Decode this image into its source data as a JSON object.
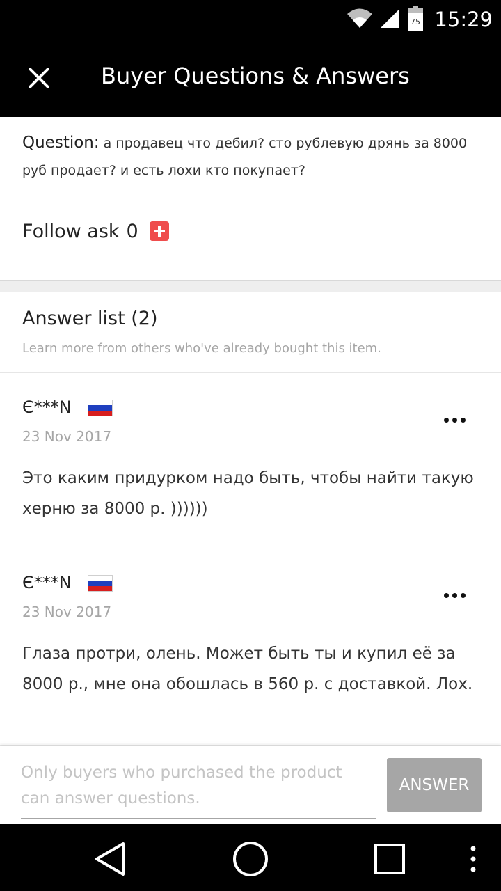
{
  "status_bar": {
    "time": "15:29",
    "battery_level": "75",
    "icons": [
      "wifi-icon",
      "cellular-signal-icon",
      "battery-icon"
    ]
  },
  "header": {
    "title": "Buyer Questions & Answers",
    "close_icon": "close-icon"
  },
  "question": {
    "label": "Question:",
    "text": "а продавец что дебил? сто рублевую дрянь за 8000 руб продает? и есть лохи кто покупает?",
    "follow_label": "Follow ask",
    "follow_count": "0",
    "follow_icon": "plus-icon"
  },
  "answers": {
    "title": "Answer list (2)",
    "subtitle": "Learn more from others who've already bought this item.",
    "items": [
      {
        "user": "Є***N",
        "flag": "russia-flag-icon",
        "date": "23 Nov 2017",
        "text": "Это каким придурком надо быть, чтобы найти такую херню за 8000 р. ))))))"
      },
      {
        "user": "Є***N",
        "flag": "russia-flag-icon",
        "date": "23 Nov 2017",
        "text": "Глаза протри, олень. Может быть ты и купил её за 8000 р., мне она обошлась в 560 р. с доставкой. Лох."
      }
    ]
  },
  "answer_bar": {
    "placeholder": "Only buyers who purchased the product can answer questions.",
    "button_label": "ANSWER"
  },
  "nav_bar": {
    "icons": [
      "back-icon",
      "home-icon",
      "recents-icon",
      "overflow-menu-icon"
    ]
  },
  "colors": {
    "app_bar": "#000000",
    "follow_plus": "#ef4d4d",
    "answer_button": "#a6a6a6",
    "muted_text": "#a6a6a6"
  }
}
